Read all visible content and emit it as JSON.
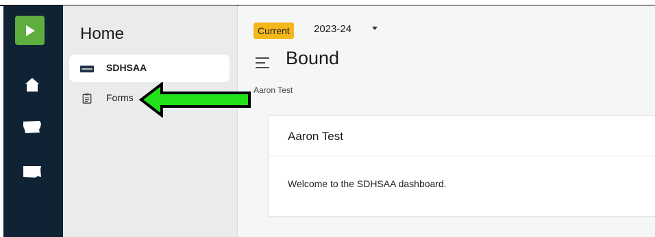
{
  "rail": {
    "items": [
      {
        "name": "play",
        "icon": "play-icon"
      },
      {
        "name": "home",
        "icon": "home-icon"
      },
      {
        "name": "iowa",
        "icon": "iowa-map-icon"
      },
      {
        "name": "south-dakota",
        "icon": "south-dakota-map-icon"
      }
    ],
    "colors": {
      "background": "#0f2335",
      "play": "#5fad3f"
    }
  },
  "sidebar": {
    "title": "Home",
    "items": [
      {
        "label": "SDHSAA",
        "icon": "organization-logo-icon",
        "active": true
      },
      {
        "label": "Forms",
        "icon": "clipboard-icon",
        "active": false
      }
    ]
  },
  "header": {
    "badge": "Current",
    "year": "2023-24",
    "title": "Bound",
    "breadcrumb": "Aaron Test",
    "badge_color": "#f4b81c"
  },
  "card": {
    "title": "Aaron Test",
    "text": "Welcome to the SDHSAA dashboard."
  },
  "annotation": {
    "icon": "green-arrow-icon",
    "color": "#22e01a"
  }
}
